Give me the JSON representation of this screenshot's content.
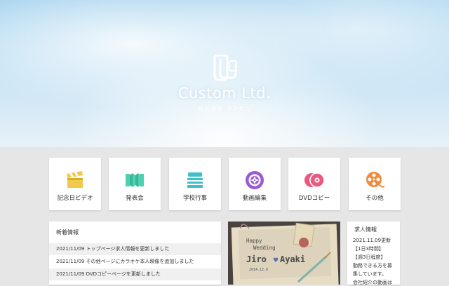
{
  "hero": {
    "brand_name": "Custom Ltd.",
    "brand_sub": "株式会社 カスタム",
    "logo_icon": "film-reel-logo-icon"
  },
  "services": [
    {
      "label": "記念日ビデオ",
      "icon": "clapperboard-icon",
      "color": "#f2c94c"
    },
    {
      "label": "発表会",
      "icon": "accordion-icon",
      "color": "#4ed1b1"
    },
    {
      "label": "学校行事",
      "icon": "school-desk-icon",
      "color": "#3ec1c9"
    },
    {
      "label": "動画編集",
      "icon": "camera-aperture-icon",
      "color": "#9b5ad6"
    },
    {
      "label": "DVDコピー",
      "icon": "dvd-disc-icon",
      "color": "#e85a82"
    },
    {
      "label": "その他",
      "icon": "film-reel-icon",
      "color": "#f08a3c"
    }
  ],
  "news": {
    "title": "新着情報",
    "items": [
      "2021/11/09 トップページ求人情報を更新しました",
      "2021/11/09 その他ページにカラオケ本人映像を追加しました",
      "2021/11/09 DVDコピーページを更新しました"
    ]
  },
  "photo": {
    "line1": "Happy",
    "line2": "Wedding",
    "names_left": "Jiro",
    "names_right": "Ayaki",
    "date": "2014.12.6"
  },
  "recruit": {
    "title": "求人情報",
    "lines": [
      "2021.11.09更新",
      "【1日3時間】",
      "【週3日程度】",
      "勤務できる方を募",
      "集しています。",
      "会社紹介の動画は"
    ]
  }
}
